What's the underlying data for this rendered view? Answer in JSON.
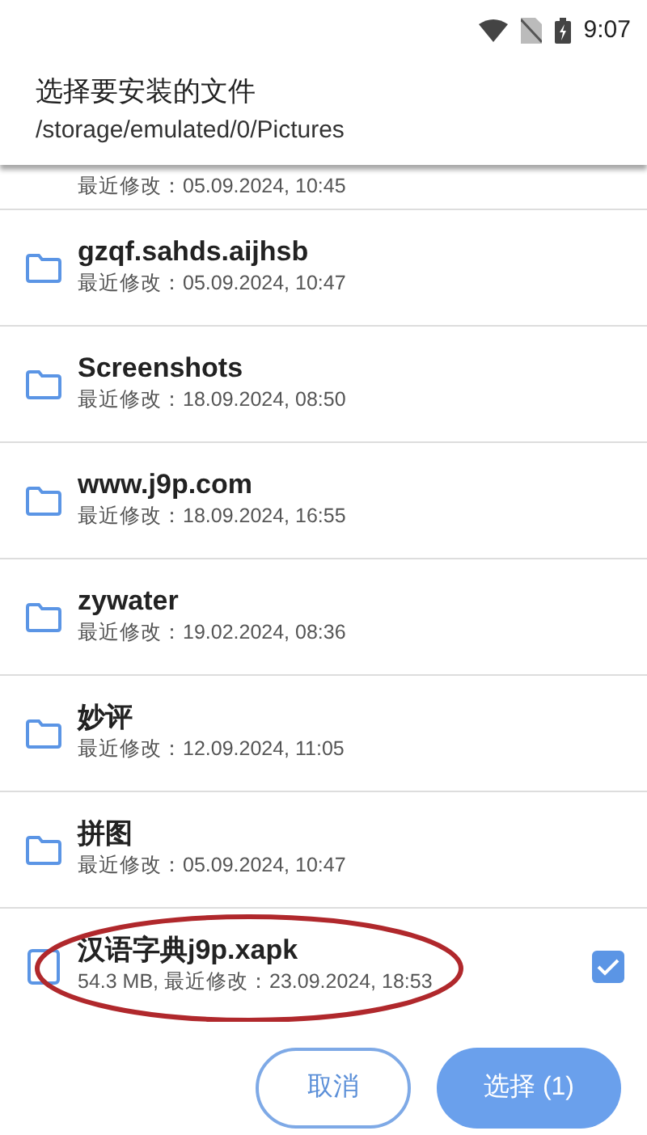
{
  "status_bar": {
    "time": "9:07"
  },
  "header": {
    "title": "选择要安装的文件",
    "path": "/storage/emulated/0/Pictures"
  },
  "items": [
    {
      "kind": "partial",
      "subtitle": "最近修改：05.09.2024, 10:45"
    },
    {
      "kind": "folder",
      "name": "gzqf.sahds.aijhsb",
      "subtitle": "最近修改：05.09.2024, 10:47"
    },
    {
      "kind": "folder",
      "name": "Screenshots",
      "subtitle": "最近修改：18.09.2024, 08:50"
    },
    {
      "kind": "folder",
      "name": "www.j9p.com",
      "subtitle": "最近修改：18.09.2024, 16:55"
    },
    {
      "kind": "folder",
      "name": "zywater",
      "subtitle": "最近修改：19.02.2024, 08:36"
    },
    {
      "kind": "folder",
      "name": "妙评",
      "subtitle": "最近修改：12.09.2024, 11:05"
    },
    {
      "kind": "folder",
      "name": "拼图",
      "subtitle": "最近修改：05.09.2024, 10:47"
    },
    {
      "kind": "file",
      "name": "汉语字典j9p.xapk",
      "subtitle": "54.3 MB, 最近修改：23.09.2024, 18:53",
      "checked": true,
      "circled": true
    }
  ],
  "buttons": [
    {
      "label": "取消",
      "kind": "outline"
    },
    {
      "label": "选择 (1)",
      "kind": "primary"
    }
  ]
}
